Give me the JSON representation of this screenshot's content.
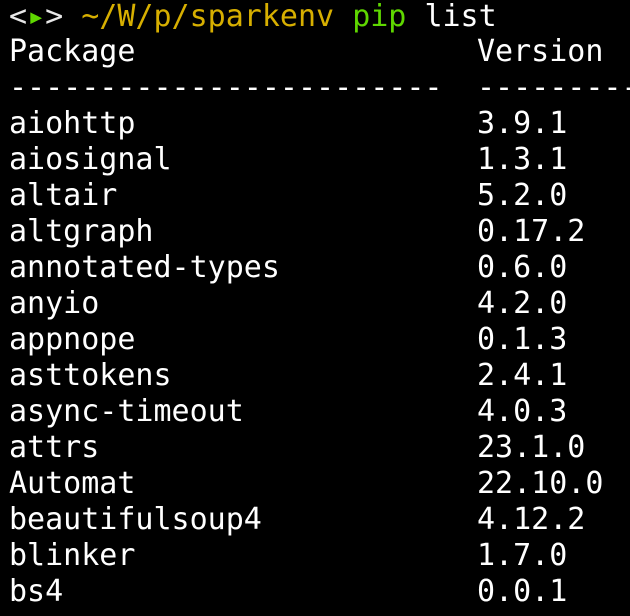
{
  "prompt": {
    "open_bracket": "<",
    "arrow": "▸",
    "close_bracket": ">",
    "path": "~/W/p/sparkenv",
    "command": "pip",
    "args": "list"
  },
  "table": {
    "headers": [
      "Package",
      "Version"
    ],
    "separators": [
      "------------------------",
      "---------"
    ],
    "rows": [
      {
        "name": "aiohttp",
        "version": "3.9.1"
      },
      {
        "name": "aiosignal",
        "version": "1.3.1"
      },
      {
        "name": "altair",
        "version": "5.2.0"
      },
      {
        "name": "altgraph",
        "version": "0.17.2"
      },
      {
        "name": "annotated-types",
        "version": "0.6.0"
      },
      {
        "name": "anyio",
        "version": "4.2.0"
      },
      {
        "name": "appnope",
        "version": "0.1.3"
      },
      {
        "name": "asttokens",
        "version": "2.4.1"
      },
      {
        "name": "async-timeout",
        "version": "4.0.3"
      },
      {
        "name": "attrs",
        "version": "23.1.0"
      },
      {
        "name": "Automat",
        "version": "22.10.0"
      },
      {
        "name": "beautifulsoup4",
        "version": "4.12.2"
      },
      {
        "name": "blinker",
        "version": "1.7.0"
      },
      {
        "name": "bs4",
        "version": "0.0.1"
      }
    ]
  },
  "colors": {
    "background": "#000000",
    "text": "#ffffff",
    "prompt_arrow": "#5fd700",
    "prompt_path": "#d7af00",
    "command": "#5fd700"
  }
}
